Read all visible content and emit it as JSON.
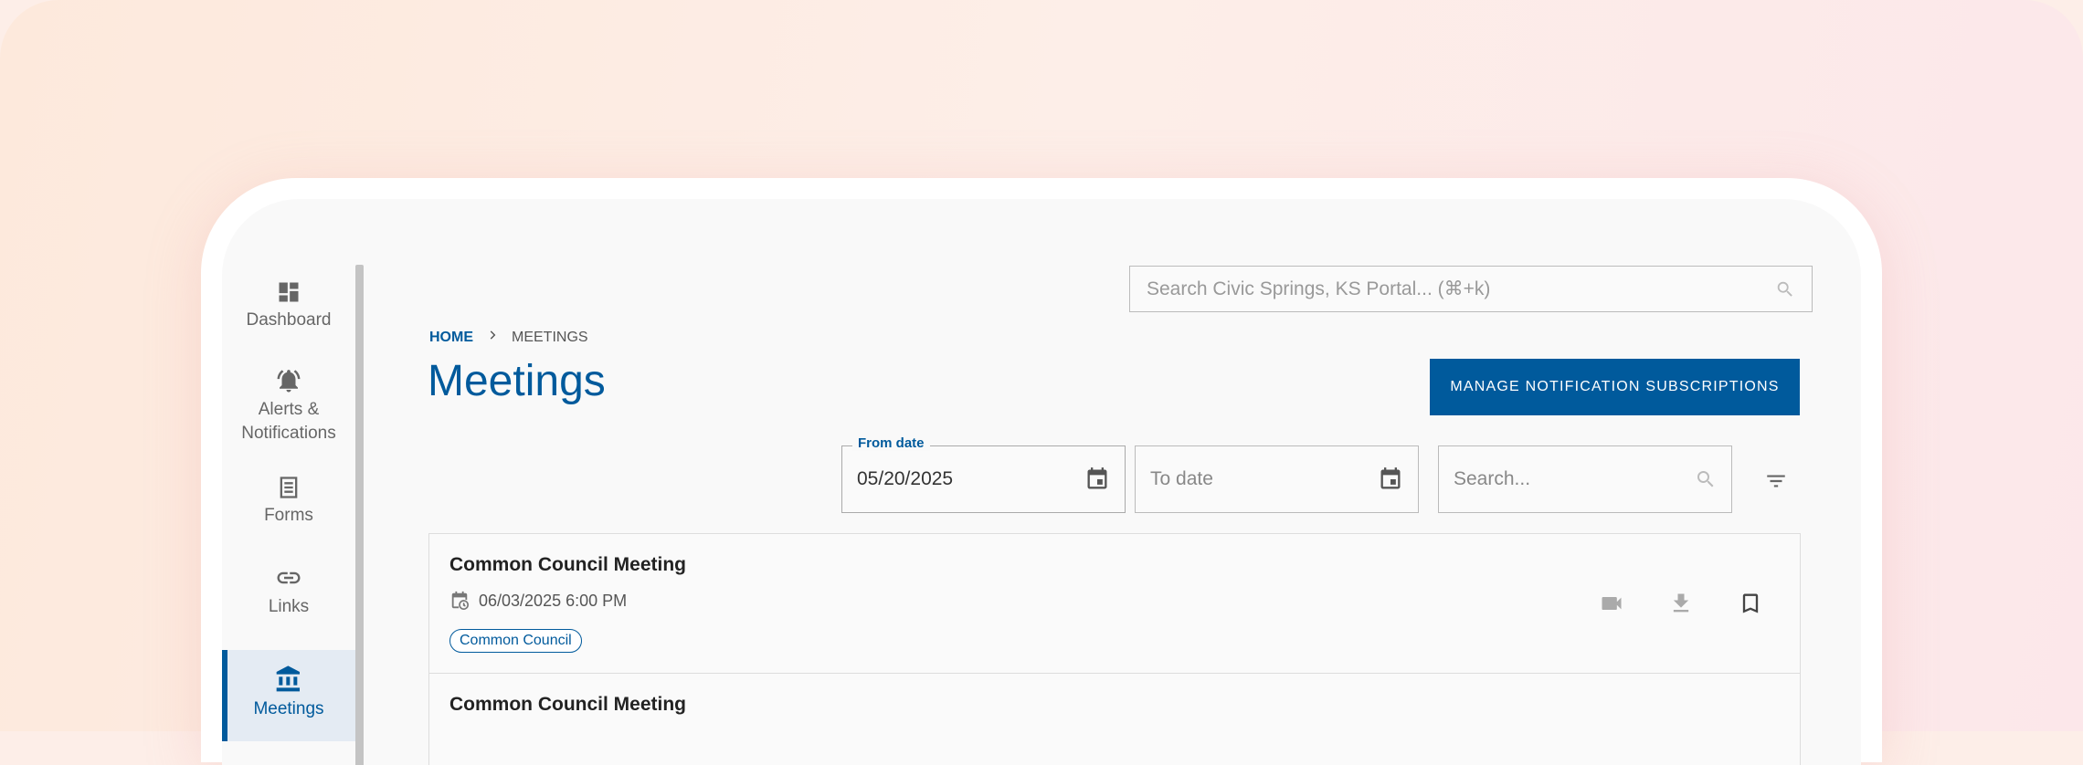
{
  "sidebar": {
    "items": [
      {
        "label": "Dashboard",
        "icon": "dashboard-icon"
      },
      {
        "label": "Alerts & Notifications",
        "icon": "bell-icon"
      },
      {
        "label": "Forms",
        "icon": "form-icon"
      },
      {
        "label": "Links",
        "icon": "link-icon"
      },
      {
        "label": "Meetings",
        "icon": "bank-icon",
        "active": true
      }
    ]
  },
  "search": {
    "placeholder": "Search Civic Springs, KS Portal... (⌘+k)"
  },
  "breadcrumb": {
    "home": "HOME",
    "current": "MEETINGS"
  },
  "page": {
    "title": "Meetings"
  },
  "actions": {
    "manage_subscriptions": "MANAGE NOTIFICATION SUBSCRIPTIONS"
  },
  "filters": {
    "from_label": "From date",
    "from_value": "05/20/2025",
    "to_placeholder": "To date",
    "search_placeholder": "Search..."
  },
  "meetings": [
    {
      "title": "Common Council Meeting",
      "datetime": "06/03/2025 6:00 PM",
      "tag": "Common Council"
    },
    {
      "title": "Common Council Meeting"
    }
  ],
  "colors": {
    "accent": "#005a9c",
    "text": "#222222",
    "muted": "#888888"
  }
}
